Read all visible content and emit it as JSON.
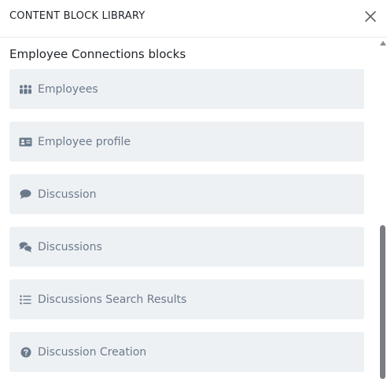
{
  "header": {
    "title": "CONTENT BLOCK LIBRARY",
    "close_icon": "close-icon"
  },
  "section": {
    "title": "Employee Connections blocks"
  },
  "blocks": [
    {
      "label": "Employees",
      "icon": "people-group-icon"
    },
    {
      "label": "Employee profile",
      "icon": "id-card-icon"
    },
    {
      "label": "Discussion",
      "icon": "speech-bubble-icon"
    },
    {
      "label": "Discussions",
      "icon": "speech-bubbles-icon"
    },
    {
      "label": "Discussions Search Results",
      "icon": "list-icon"
    },
    {
      "label": "Discussion Creation",
      "icon": "question-circle-icon"
    }
  ],
  "colors": {
    "block_bg": "#eef1f4",
    "block_text": "#6b7a8b",
    "icon": "#6b7a8b",
    "header_border": "#e8ebef"
  }
}
